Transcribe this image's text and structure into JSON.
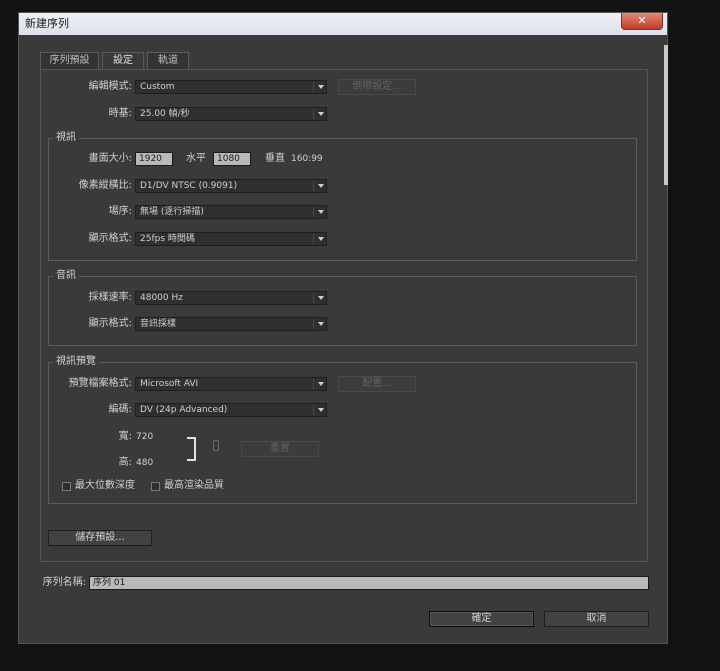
{
  "window": {
    "title": "新建序列",
    "close_glyph": "✕"
  },
  "tabs": [
    {
      "label": "序列預設"
    },
    {
      "label": "設定"
    },
    {
      "label": "軌道"
    }
  ],
  "general": {
    "editing_mode_label": "編輯模式:",
    "editing_mode_value": "Custom",
    "playback_settings_label": "倒帶設定...",
    "timebase_label": "時基:",
    "timebase_value": "25.00 幀/秒"
  },
  "video": {
    "title": "視訊",
    "frame_size_label": "畫面大小:",
    "frame_width": "1920",
    "horizontal_label": "水平",
    "frame_height": "1080",
    "vertical_label": "垂直",
    "aspect": "160:99",
    "pixel_aspect_label": "像素縱橫比:",
    "pixel_aspect_value": "D1/DV NTSC (0.9091)",
    "fields_label": "場序:",
    "fields_value": "無場 (逐行掃描)",
    "display_format_label": "顯示格式:",
    "display_format_value": "25fps 時間碼"
  },
  "audio": {
    "title": "音訊",
    "sample_rate_label": "採樣速率:",
    "sample_rate_value": "48000 Hz",
    "display_format_label": "顯示格式:",
    "display_format_value": "音訊採樣"
  },
  "preview": {
    "title": "視訊預覽",
    "file_format_label": "預覽檔案格式:",
    "file_format_value": "Microsoft AVI",
    "configure_label": "配置...",
    "codec_label": "編碼:",
    "codec_value": "DV (24p Advanced)",
    "width_label": "寬:",
    "width_value": "720",
    "height_label": "高:",
    "height_value": "480",
    "reset_label": "重置",
    "max_bit_depth_label": "最大位數深度",
    "max_render_quality_label": "最高渲染品質"
  },
  "save_preset_label": "儲存預設...",
  "sequence_name_label": "序列名稱:",
  "sequence_name_value": "序列 01",
  "ok_label": "確定",
  "cancel_label": "取消"
}
